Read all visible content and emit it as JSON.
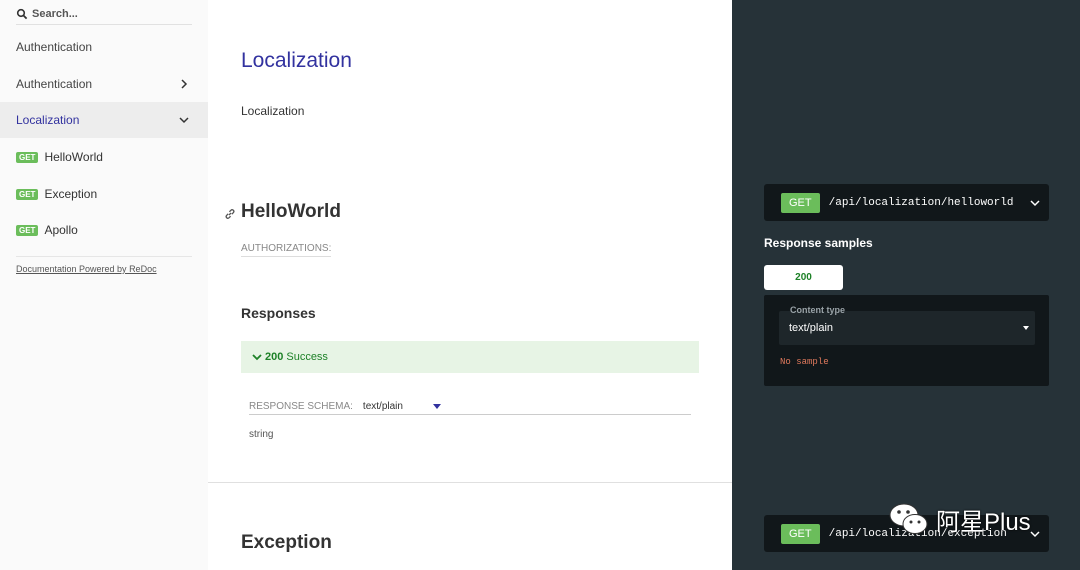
{
  "sidebar": {
    "search_placeholder": "Search...",
    "items": [
      {
        "label": "Authentication"
      },
      {
        "label": "Authentication"
      },
      {
        "label": "Localization"
      }
    ],
    "operations": [
      {
        "method": "GET",
        "label": "HelloWorld"
      },
      {
        "method": "GET",
        "label": "Exception"
      },
      {
        "method": "GET",
        "label": "Apollo"
      }
    ],
    "powered_by": "Documentation Powered by ReDoc"
  },
  "main": {
    "section_title": "Localization",
    "section_description": "Localization",
    "operation": {
      "title": "HelloWorld",
      "authorizations_label": "AUTHORIZATIONS:",
      "responses_title": "Responses",
      "response": {
        "code": "200",
        "label": "Success"
      },
      "schema_label": "RESPONSE SCHEMA:",
      "schema_type": "text/plain",
      "schema_value": "string"
    },
    "next_operation_title": "Exception"
  },
  "right_panel": {
    "endpoint1": {
      "method": "GET",
      "path": "/api/localization/helloworld"
    },
    "response_samples_title": "Response samples",
    "sample_tab": "200",
    "content_type_label": "Content type",
    "content_type_value": "text/plain",
    "no_sample": "No sample",
    "endpoint2": {
      "method": "GET",
      "path": "/api/localization/exception"
    }
  },
  "watermark": {
    "text": "阿星Plus"
  },
  "colors": {
    "accent": "#32329f",
    "get_badge": "#6bbd5b",
    "success_text": "#1d8127",
    "success_bg": "#e7f4e5",
    "right_bg": "#263238",
    "code_bg": "#11171a"
  }
}
